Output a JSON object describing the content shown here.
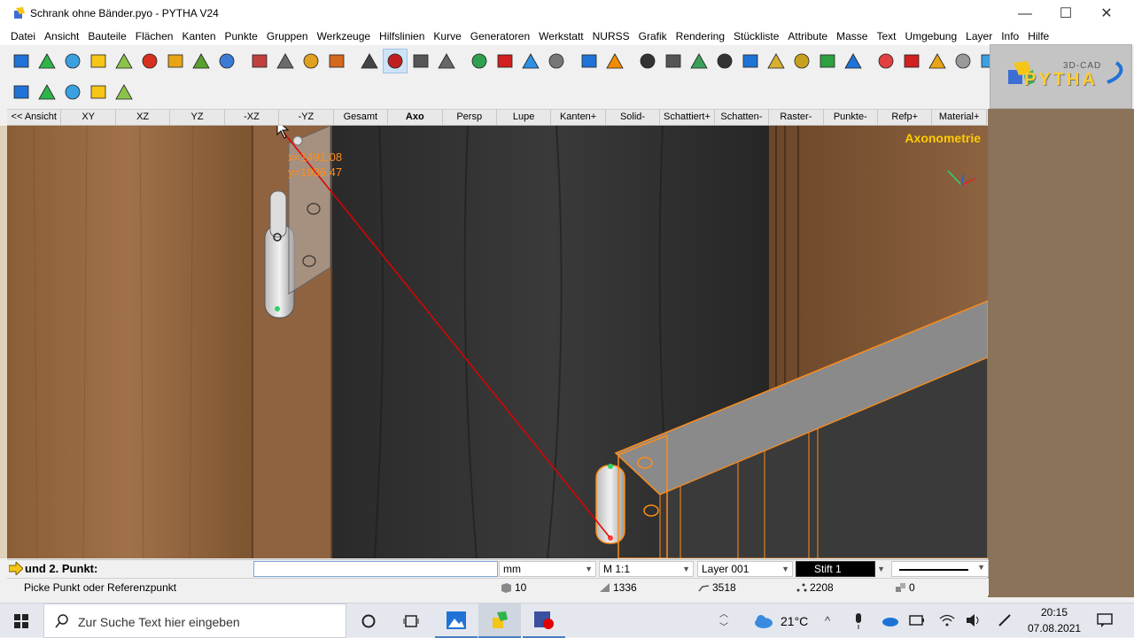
{
  "window": {
    "title": "Schrank ohne Bänder.pyo - PYTHA V24",
    "minimize": "—",
    "maximize": "☐",
    "close": "✕"
  },
  "menu": [
    "Datei",
    "Ansicht",
    "Bauteile",
    "Flächen",
    "Kanten",
    "Punkte",
    "Gruppen",
    "Werkzeuge",
    "Hilfslinien",
    "Kurve",
    "Generatoren",
    "Werkstatt",
    "NURSS",
    "Grafik",
    "Rendering",
    "Stückliste",
    "Attribute",
    "Masse",
    "Text",
    "Umgebung",
    "Layer",
    "Info",
    "Hilfe"
  ],
  "toolbar1_icons": [
    "box-icon",
    "extrude-icon",
    "plane-icon",
    "star-icon",
    "circle-icon",
    "curve-icon",
    "gear-icon",
    "drill-icon",
    "plate-icon",
    "hammer-icon",
    "hammer2-icon",
    "hammer3-icon",
    "pencil-icon",
    "camera-icon",
    "render-icon",
    "eye-icon",
    "print-icon",
    "upload-icon",
    "download-icon",
    "drop-icon",
    "cup-icon",
    "undo-icon",
    "redo-icon",
    "attr-icon",
    "list-icon",
    "table-icon",
    "scale-icon",
    "copy-icon",
    "hatch-icon",
    "layers-icon",
    "tree-icon",
    "info-icon",
    "refresh-icon",
    "delete-icon",
    "move-icon",
    "move2-icon",
    "box2-icon"
  ],
  "toolbar2_icons": [
    "workbench-icon",
    "saw-icon",
    "wood-icon",
    "panel-icon",
    "dimension-icon"
  ],
  "logo": {
    "small": "3D-CAD",
    "big": "PYTHA"
  },
  "view_tabs": [
    "<< Ansicht",
    "XY",
    "XZ",
    "YZ",
    "-XZ",
    "-YZ",
    "Gesamt",
    "Axo",
    "Persp",
    "Lupe",
    "Kanten+",
    "Solid-",
    "Schattiert+",
    "Schatten-",
    "Raster-",
    "Punkte-",
    "Refp+",
    "Material+"
  ],
  "viewport": {
    "label": "Axonometrie",
    "coord_x": "x=1491.08",
    "coord_y": "y=1936.47"
  },
  "command": {
    "prompt": "und 2. Punkt:",
    "input_value": "",
    "unit": "mm",
    "scale": "M 1:1",
    "layer": "Layer 001",
    "pen": "Stift 1"
  },
  "status": {
    "hint": "Picke Punkt oder Referenzpunkt",
    "parts": "10",
    "faces": "1336",
    "edges": "3518",
    "points": "2208",
    "groups": "0"
  },
  "taskbar": {
    "search_placeholder": "Zur Suche Text hier eingeben",
    "temperature": "21°C",
    "time": "20:15",
    "date": "07.08.2021"
  }
}
